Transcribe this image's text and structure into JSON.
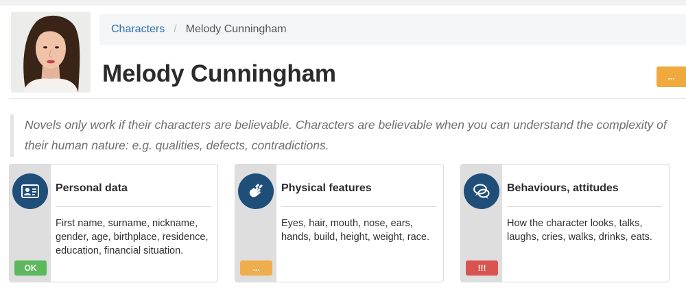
{
  "breadcrumb": {
    "parent": "Characters",
    "separator": "/",
    "current": "Melody Cunningham"
  },
  "title": "Melody Cunningham",
  "menu_button_label": "...",
  "intro": "Novels only work if their characters are believable. Characters are believable when you can understand the complexity of their human nature: e.g. qualities, defects, contradictions.",
  "colors": {
    "accent_blue": "#1f4e79",
    "link_blue": "#2a6faf",
    "ok_green": "#5cb85c",
    "pending_orange": "#f0a93d",
    "alert_red": "#d9534f"
  },
  "cards": [
    {
      "title": "Personal data",
      "description": "First name, surname, nickname, gender, age, birthplace, residence, education, financial situation.",
      "badge": "OK",
      "badge_color": "#5cb85c",
      "icon": "id-card-icon"
    },
    {
      "title": "Physical features",
      "description": "Eyes, hair, mouth, nose, ears, hands, build, height, weight, race.",
      "badge": "...",
      "badge_color": "#f0ad4e",
      "icon": "sign-language-icon"
    },
    {
      "title": "Behaviours, attitudes",
      "description": "How the character looks, talks, laughs, cries, walks, drinks, eats.",
      "badge": "!!!",
      "badge_color": "#d9534f",
      "icon": "chat-bubbles-icon"
    }
  ]
}
